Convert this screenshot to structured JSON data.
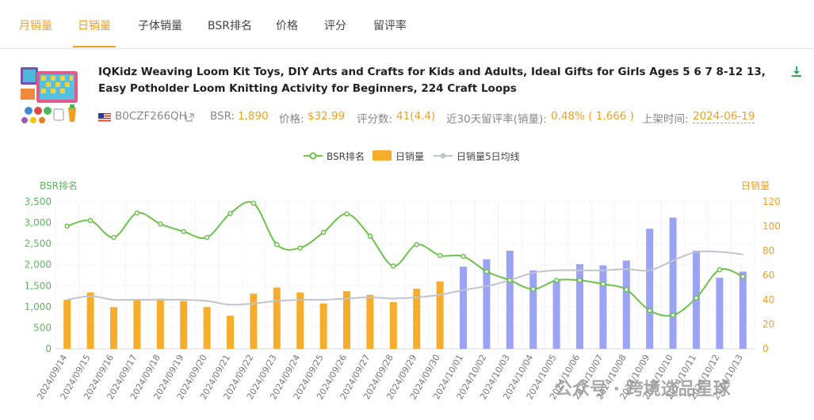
{
  "tabs": [
    {
      "label": "月销量",
      "active": false
    },
    {
      "label": "日销量",
      "active": true
    },
    {
      "label": "子体销量",
      "active": false
    },
    {
      "label": "BSR排名",
      "active": false
    },
    {
      "label": "价格",
      "active": false
    },
    {
      "label": "评分",
      "active": false
    },
    {
      "label": "留评率",
      "active": false
    }
  ],
  "product": {
    "title": "IQKidz Weaving Loom Kit Toys, DIY Arts and Crafts for Kids and Adults, Ideal Gifts for Girls Ages 5 6 7 8-12 13, Easy Potholder Loom Knitting Activity for Beginners, 224 Craft Loops",
    "asin": "B0CZF266QH",
    "bsr_label": "BSR:",
    "bsr_value": "1,890",
    "price_label": "价格:",
    "price_value": "$32.99",
    "reviews_label": "评分数:",
    "reviews_value": "41(4.4)",
    "review_rate_label": "近30天留评率(销量):",
    "review_rate_value": "0.48% ( 1,666 )",
    "listed_label": "上架时间:",
    "listed_value": "2024-06-19"
  },
  "colors": {
    "bsr_line": "#6cc24a",
    "bar_orange": "#f7ad2c",
    "bar_purple": "#9ba3f4",
    "avg_line": "#c0c4cc",
    "accent": "#f0a020"
  },
  "icons": {
    "download": "download-icon",
    "flag": "us-flag-icon",
    "external": "external-link-icon"
  },
  "chart_data": {
    "type": "bar",
    "legend": [
      "BSR排名",
      "日销量",
      "日销量5日均线"
    ],
    "left_axis_title": "BSR排名",
    "right_axis_title": "日销量",
    "left_ylim": [
      0,
      3500
    ],
    "left_ticks": [
      "0",
      "500",
      "1,000",
      "1,500",
      "2,000",
      "2,500",
      "3,000",
      "3,500"
    ],
    "right_ylim": [
      0,
      120
    ],
    "right_ticks": [
      "0",
      "20",
      "40",
      "60",
      "80",
      "100",
      "120"
    ],
    "categories": [
      "2024/09/14",
      "2024/09/15",
      "2024/09/16",
      "2024/09/17",
      "2024/09/18",
      "2024/09/19",
      "2024/09/20",
      "2024/09/21",
      "2024/09/22",
      "2024/09/23",
      "2024/09/24",
      "2024/09/25",
      "2024/09/26",
      "2024/09/27",
      "2024/09/28",
      "2024/09/29",
      "2024/09/30",
      "2024/10/01",
      "2024/10/02",
      "2024/10/03",
      "2024/10/04",
      "2024/10/05",
      "2024/10/06",
      "2024/10/07",
      "2024/10/08",
      "2024/10/09",
      "2024/10/10",
      "2024/10/11",
      "2024/10/12",
      "2024/10/13"
    ],
    "series": [
      {
        "name": "BSR排名",
        "axis": "left",
        "values": [
          2920,
          3050,
          2650,
          3230,
          2970,
          2790,
          2650,
          3220,
          3460,
          2480,
          2400,
          2770,
          3210,
          2680,
          1970,
          2480,
          2220,
          2200,
          1840,
          1630,
          1420,
          1630,
          1630,
          1540,
          1410,
          910,
          800,
          1210,
          1880,
          1720
        ]
      },
      {
        "name": "日销量",
        "axis": "right",
        "values": [
          40,
          46,
          34,
          40,
          41,
          39,
          34,
          27,
          45,
          50,
          46,
          37,
          47,
          44,
          38,
          49,
          55,
          67,
          73,
          80,
          64,
          56,
          69,
          68,
          72,
          98,
          107,
          80,
          58,
          63
        ]
      },
      {
        "name": "日销量5日均线",
        "axis": "right",
        "values": [
          40,
          43,
          40,
          40,
          40,
          40,
          39,
          36,
          37,
          39,
          40,
          40,
          41,
          42,
          41,
          42,
          44,
          48,
          51,
          56,
          62,
          64,
          64,
          64,
          65,
          64,
          72,
          79,
          79,
          77
        ]
      }
    ],
    "bar_color_change_index": 17,
    "watermark": "公众号 · 跨境选品星球"
  }
}
